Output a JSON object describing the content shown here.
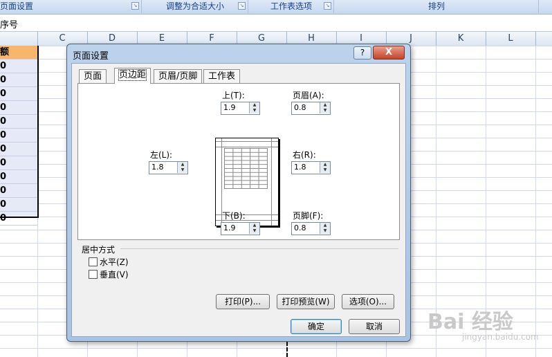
{
  "ribbon": {
    "groups": [
      "页面设置",
      "调整为合适大小",
      "工作表选项",
      "排列"
    ]
  },
  "formula_bar": {
    "text": "序号"
  },
  "columns": [
    "C",
    "D",
    "E",
    "F",
    "G",
    "H",
    "I",
    "J",
    "K",
    "L"
  ],
  "sheet": {
    "header_cell": "额",
    "values": [
      "0",
      "0",
      "0",
      "0",
      "0",
      "0",
      "0",
      "0",
      "0",
      "0",
      "0",
      "0"
    ]
  },
  "dialog": {
    "title": "页面设置",
    "help": "?",
    "close": "X",
    "tabs": [
      "页面",
      "页边距",
      "页眉/页脚",
      "工作表"
    ],
    "active_tab": "页边距",
    "margins": {
      "top_label": "上(T):",
      "top": "1.9",
      "header_label": "页眉(A):",
      "header": "0.8",
      "left_label": "左(L):",
      "left": "1.8",
      "right_label": "右(R):",
      "right": "1.8",
      "bottom_label": "下(B):",
      "bottom": "1.9",
      "footer_label": "页脚(F):",
      "footer": "0.8"
    },
    "center_section": {
      "title": "居中方式",
      "horizontal": "水平(Z)",
      "vertical": "垂直(V)",
      "horizontal_checked": false,
      "vertical_checked": false
    },
    "buttons": {
      "print": "打印(P)...",
      "preview": "打印预览(W)",
      "options": "选项(O)...",
      "ok": "确定",
      "cancel": "取消"
    }
  },
  "watermark": {
    "big": "Bai 经验",
    "small": "jingyan.baidu.com"
  }
}
